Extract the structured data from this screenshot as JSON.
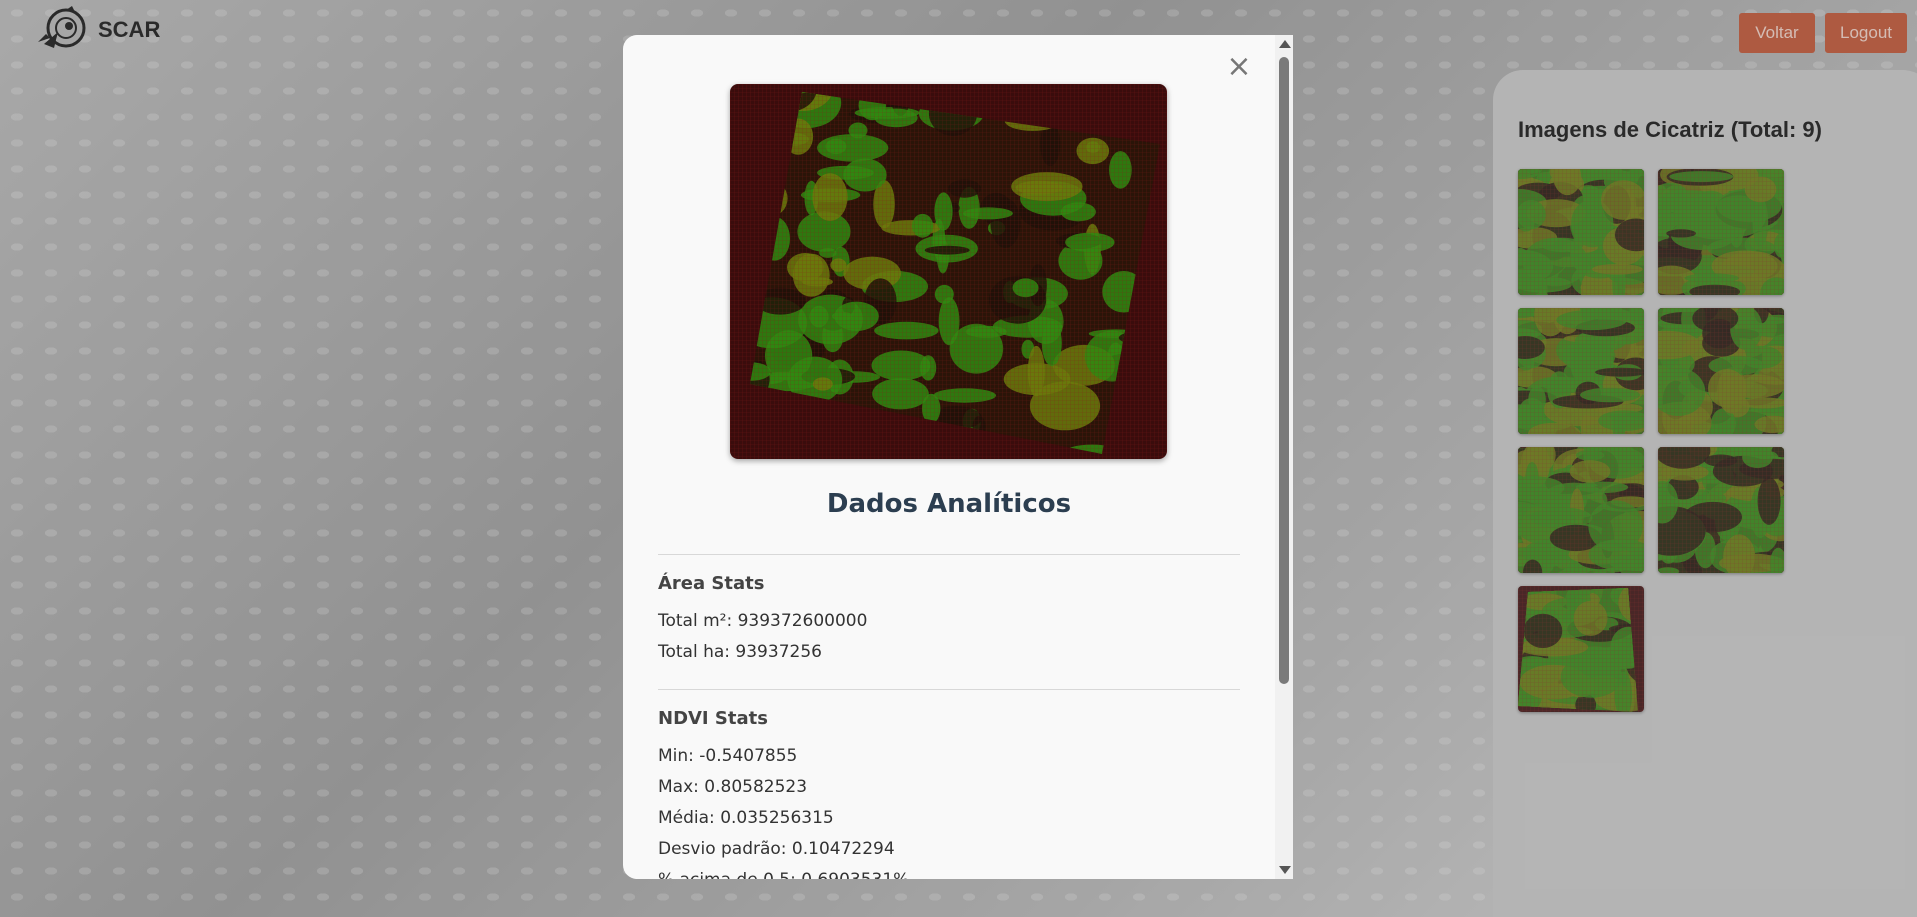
{
  "header": {
    "logo_text": "SCAR",
    "voltar_label": "Voltar",
    "logout_label": "Logout"
  },
  "panel": {
    "title": "Imagens de Cicatriz (Total: 9)",
    "thumbnails_visible": 7
  },
  "modal": {
    "close_label": "×",
    "title": "Dados Analíticos",
    "area": {
      "heading": "Área Stats",
      "total_m2": "Total m²: 939372600000",
      "total_ha": "Total ha: 93937256"
    },
    "ndvi": {
      "heading": "NDVI Stats",
      "min": "Min: -0.5407855",
      "max": "Max: 0.80582523",
      "media": "Média: 0.035256315",
      "desvio": "Desvio padrão: 0.10472294",
      "pct_acima": "% acima de 0.5: 0.6903531%"
    }
  },
  "colors": {
    "button": "#c0502f",
    "title": "#2c3e50",
    "vegetation_green": "#2f8a10",
    "burn_dark_red": "#3a0c0c"
  }
}
